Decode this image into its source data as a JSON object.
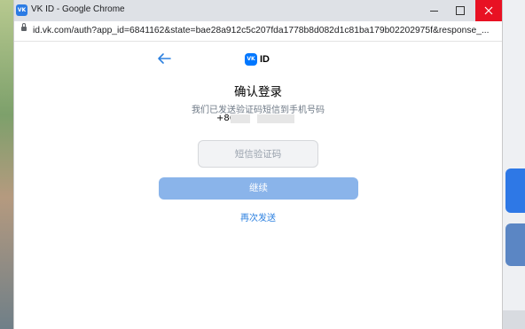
{
  "window": {
    "title": "VK ID - Google Chrome",
    "app_icon_text": "VK",
    "url": "id.vk.com/auth?app_id=6841162&state=bae28a912c5c207fda1778b8d082d1c81ba179b02202975f&response_..."
  },
  "page": {
    "logo_mark": "VK",
    "logo_text": "ID",
    "heading": "确认登录",
    "subtitle": "我们已发送验证码短信到手机号码",
    "phone_prefix": "+86",
    "code_placeholder": "短信验证码",
    "continue_label": "继续",
    "resend_label": "再次发送"
  },
  "colors": {
    "accent": "#0077ff",
    "button": "#8ab4ea",
    "link": "#2d81e0",
    "close": "#e81123"
  }
}
